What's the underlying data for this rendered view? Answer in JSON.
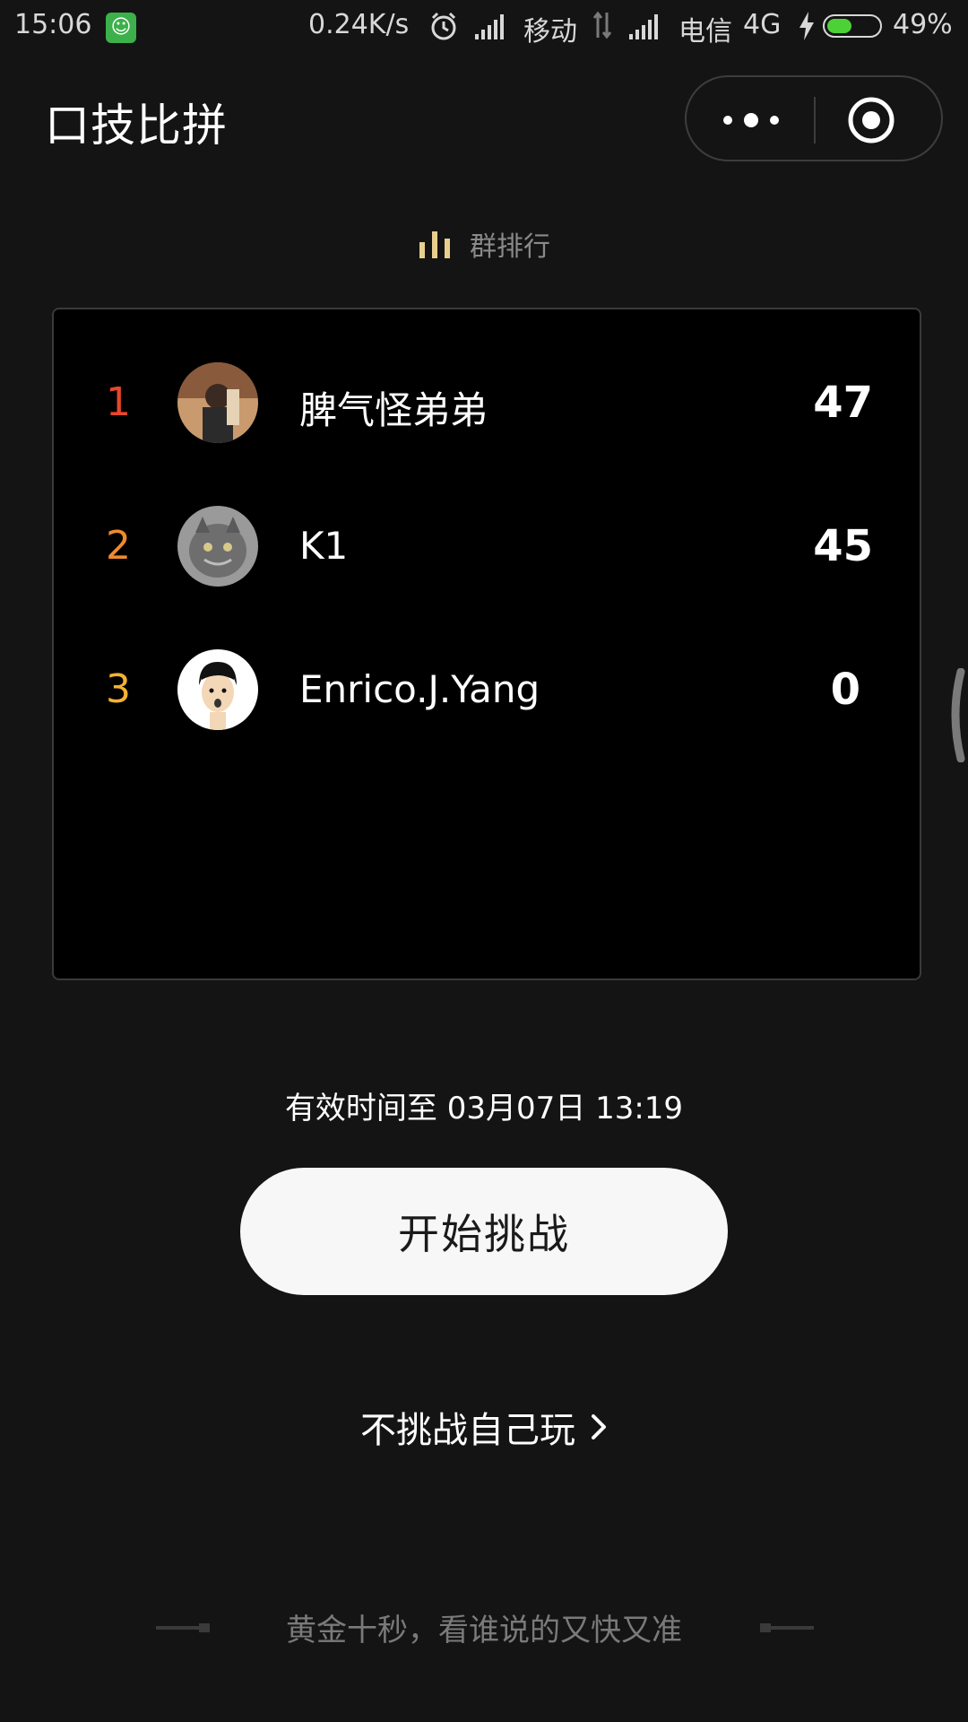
{
  "status_bar": {
    "time": "15:06",
    "net_speed": "0.24K/s",
    "carrier1": "移动",
    "carrier2": "电信",
    "network_type": "4G",
    "battery_percent_text": "49%",
    "battery_level": 0.49,
    "app_icon": "android-cat-icon",
    "battery_color": "#4cd137"
  },
  "header": {
    "title": "口技比拼",
    "more_icon": "more-dots-icon",
    "close_icon": "target-close-icon"
  },
  "ranking": {
    "label": "群排行",
    "icon": "bar-chart-icon",
    "icon_color": "#e9cf8e",
    "entries": [
      {
        "rank": "1",
        "name": "脾气怪弟弟",
        "score": "47",
        "rank_color": "#e8472a"
      },
      {
        "rank": "2",
        "name": "K1",
        "score": "45",
        "rank_color": "#f08a2c"
      },
      {
        "rank": "3",
        "name": "Enrico.J.Yang",
        "score": "0",
        "rank_color": "#f2b233"
      }
    ]
  },
  "valid_until": "有效时间至 03月07日 13:19",
  "start_button": "开始挑战",
  "self_play": "不挑战自己玩",
  "slogan": "黄金十秒，看谁说的又快又准"
}
